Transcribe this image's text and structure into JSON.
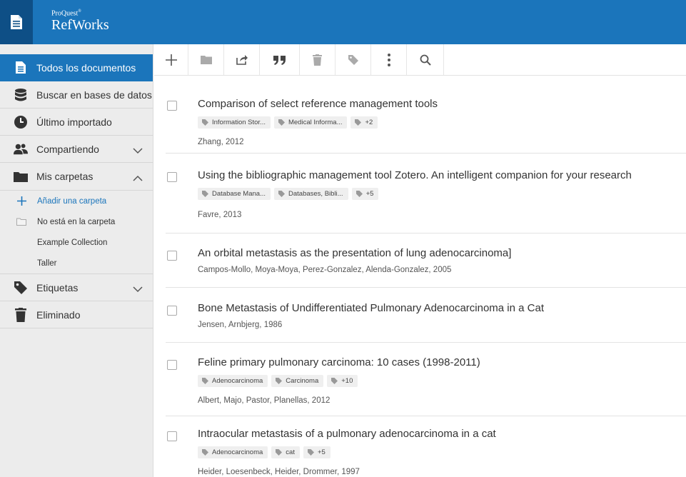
{
  "app": {
    "brand_top": "ProQuest",
    "brand_reg": "®",
    "brand_main": "RefWorks"
  },
  "sidebar": {
    "items": [
      {
        "label": "Todos los documentos",
        "icon": "document-icon",
        "active": true
      },
      {
        "label": "Buscar en bases de datos",
        "icon": "database-icon"
      },
      {
        "label": "Último importado",
        "icon": "clock-icon"
      },
      {
        "label": "Compartiendo",
        "icon": "users-icon"
      },
      {
        "label": "Mis carpetas",
        "icon": "folder-icon"
      },
      {
        "label": "Etiquetas",
        "icon": "tag-icon"
      },
      {
        "label": "Eliminado",
        "icon": "trash-icon"
      }
    ],
    "folders": {
      "add_label": "Añadir una carpeta",
      "not_in_folder_label": "No está en la carpeta",
      "collections": [
        "Example Collection",
        "Taller"
      ]
    }
  },
  "toolbar": {
    "icons": [
      "plus-icon",
      "folder-icon",
      "share-icon",
      "quote-icon",
      "trash-icon",
      "tag-icon",
      "more-vertical-icon",
      "search-icon"
    ]
  },
  "documents": [
    {
      "title": "Comparison of select reference management tools",
      "tags": [
        "Information Stor...",
        "Medical Informa...",
        "+2"
      ],
      "authors": "Zhang, 2012"
    },
    {
      "title": "Using the bibliographic management tool Zotero. An intelligent companion for your research",
      "tags": [
        "Database Mana...",
        "Databases, Bibli...",
        "+5"
      ],
      "authors": "Favre, 2013"
    },
    {
      "title": "An orbital metastasis as the presentation of lung adenocarcinoma]",
      "tags": [],
      "authors": "Campos-Mollo, Moya-Moya, Perez-Gonzalez, Alenda-Gonzalez, 2005"
    },
    {
      "title": "Bone Metastasis of Undifferentiated Pulmonary Adenocarcinoma in a Cat",
      "tags": [],
      "authors": "Jensen, Arnbjerg, 1986"
    },
    {
      "title": "Feline primary pulmonary carcinoma: 10 cases (1998-2011)",
      "tags": [
        "Adenocarcinoma",
        "Carcinoma",
        "+10"
      ],
      "authors": "Albert, Majo, Pastor, Planellas, 2012"
    },
    {
      "title": "Intraocular metastasis of a pulmonary adenocarcinoma in a cat",
      "tags": [
        "Adenocarcinoma",
        "cat",
        "+5"
      ],
      "authors": "Heider, Loesenbeck, Heider, Drommer, 1997"
    }
  ],
  "colors": {
    "brand_blue": "#1b75bb",
    "brand_dark": "#0e4f86",
    "sidebar_bg": "#ececec",
    "icon_gray": "#aaaaaa"
  }
}
